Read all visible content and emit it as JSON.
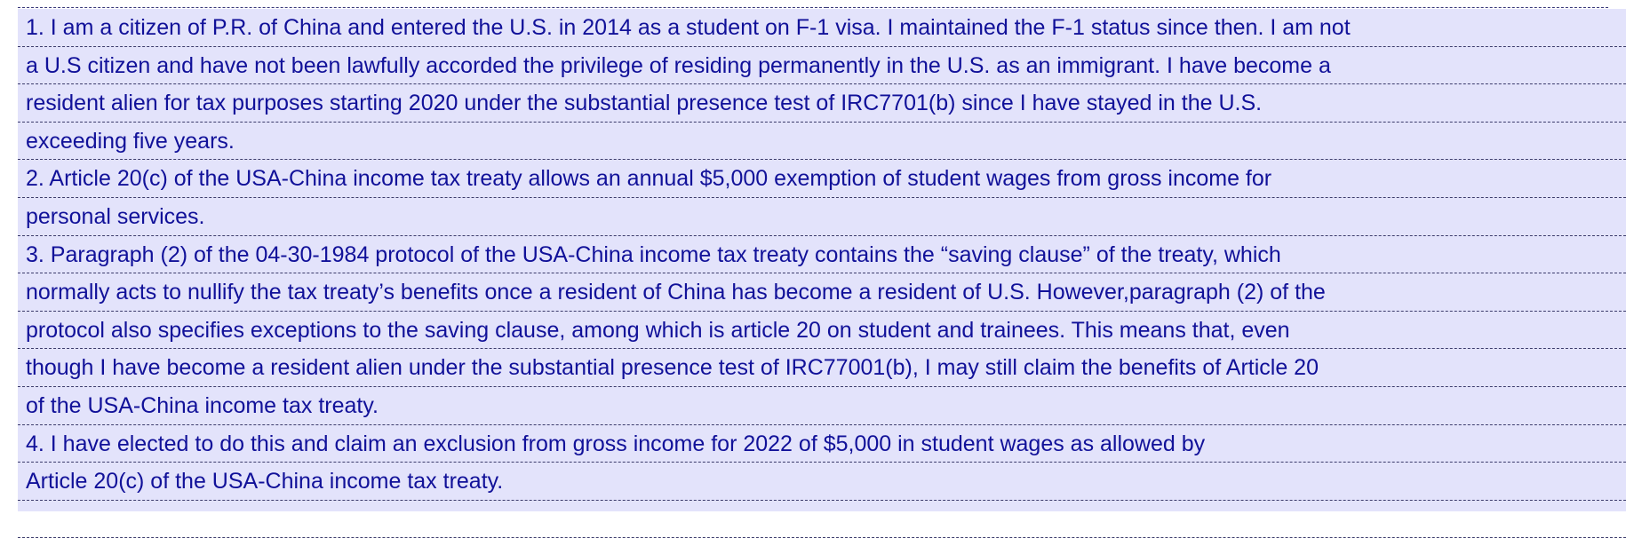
{
  "statement": {
    "lines": [
      "1. I am a citizen of P.R. of China and entered the U.S. in 2014 as a student on F-1 visa. I maintained the F-1 status since then. I am not",
      "a U.S citizen and have not been lawfully accorded the privilege of residing permanently in the U.S. as an immigrant. I have become a",
      "resident alien for tax purposes starting 2020 under the substantial presence test of IRC7701(b) since I have stayed in the U.S.",
      "exceeding five years.",
      "2. Article 20(c) of the USA-China income tax treaty allows an annual $5,000 exemption of student wages from gross income for",
      "personal services.",
      "3. Paragraph (2) of the 04-30-1984 protocol of the USA-China income tax treaty contains the “saving clause” of the treaty, which",
      "normally acts to nullify the tax treaty’s benefits once a resident of China has become a resident of U.S. However,paragraph (2) of the",
      "protocol also specifies exceptions to the saving clause, among which is article 20 on student and trainees. This means that, even",
      "though I have become a resident alien under the substantial presence test of IRC77001(b), I may still claim the benefits of Article 20",
      "of the USA-China income tax treaty.",
      "4. I have elected to do this and claim an exclusion from gross income for 2022 of $5,000 in student wages as allowed by",
      "Article 20(c) of the USA-China income tax treaty.",
      ""
    ]
  },
  "colors": {
    "field_background": "#e3e3fb",
    "text": "#111199",
    "rule": "#3c3c6c"
  }
}
